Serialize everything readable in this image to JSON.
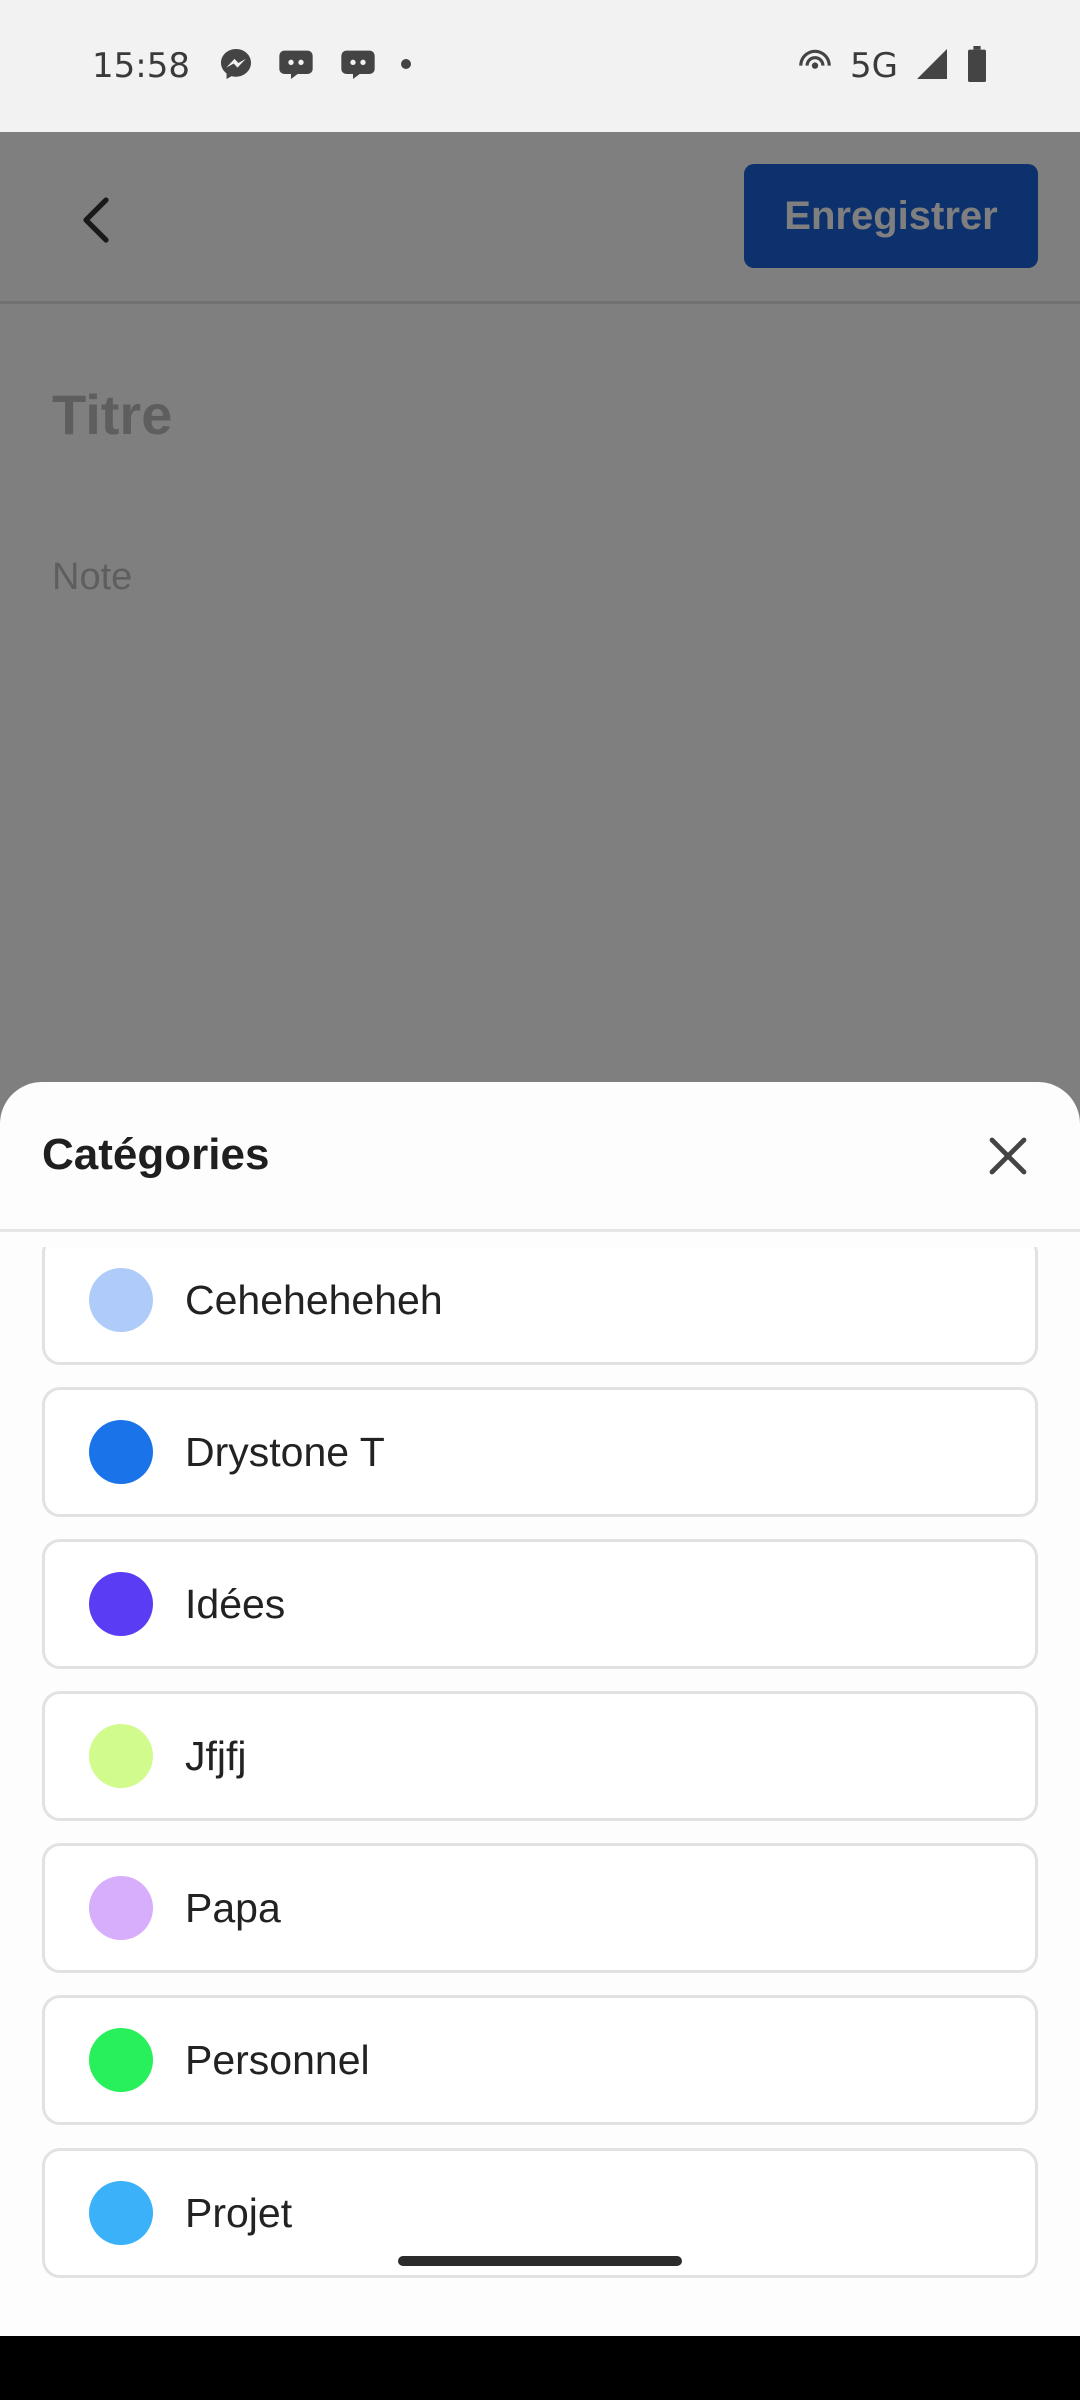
{
  "status_bar": {
    "time": "15:58",
    "network": "5G",
    "icons": [
      "messenger-icon",
      "discord-icon",
      "discord-icon",
      "dot-icon",
      "hotspot-icon",
      "signal-icon",
      "battery-icon"
    ]
  },
  "editor": {
    "save_label": "Enregistrer",
    "title_placeholder": "Titre",
    "note_placeholder": "Note"
  },
  "sheet": {
    "title": "Catégories",
    "categories": [
      {
        "label": "Ceheheheheh",
        "color": "#aecbfa"
      },
      {
        "label": "Drystone T",
        "color": "#1a73e8"
      },
      {
        "label": "Idées",
        "color": "#5b3cf5"
      },
      {
        "label": "Jfjfj",
        "color": "#d2fb8e"
      },
      {
        "label": "Papa",
        "color": "#d7aefb"
      },
      {
        "label": "Personnel",
        "color": "#27f05b"
      },
      {
        "label": "Projet",
        "color": "#3ab1f8"
      }
    ]
  },
  "colors": {
    "accent": "#1b63d8",
    "scrim": "rgba(0,0,0,0.5)"
  }
}
